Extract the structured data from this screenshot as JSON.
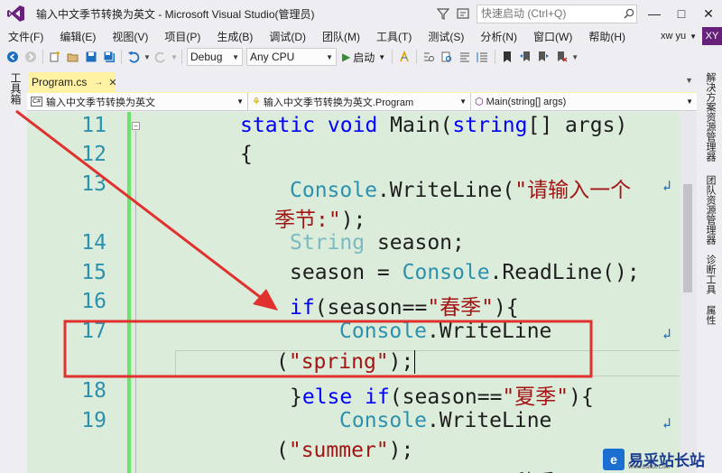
{
  "window": {
    "title": "输入中文季节转换为英文 - Microsoft Visual Studio(管理员)",
    "quick_launch_placeholder": "快速启动 (Ctrl+Q)",
    "user": "xw yu",
    "avatar": "XY"
  },
  "menu": [
    "文件(F)",
    "编辑(E)",
    "视图(V)",
    "项目(P)",
    "生成(B)",
    "调试(D)",
    "团队(M)",
    "工具(T)",
    "测试(S)",
    "分析(N)",
    "窗口(W)",
    "帮助(H)"
  ],
  "toolbar": {
    "config": "Debug",
    "platform": "Any CPU",
    "start": "启动"
  },
  "left_tab": "工具箱",
  "document_tab": "Program.cs",
  "navbar": {
    "project": "输入中文季节转换为英文",
    "class": "输入中文季节转换为英文.Program",
    "member": "Main(string[] args)"
  },
  "code_lines": [
    {
      "num": "11"
    },
    {
      "num": "12"
    },
    {
      "num": "13"
    },
    {
      "num": "14"
    },
    {
      "num": "15"
    },
    {
      "num": "16"
    },
    {
      "num": "17"
    },
    {
      "num": "18"
    },
    {
      "num": "19"
    }
  ],
  "code": {
    "l11_kw": "static void",
    "l11_rest": " Main(",
    "l11_type": "string",
    "l11_end": "[] args)",
    "l12": "{",
    "l13_type": "Console",
    "l13_method": ".WriteLine(",
    "l13_str": "\"请输入一个",
    "l13b_str": "季节:\"",
    "l13b_end": ");",
    "l14_type": "String",
    "l14_rest": " season;",
    "l15_a": "season = ",
    "l15_type": "Console",
    "l15_rest": ".ReadLine();",
    "l16_kw": "if",
    "l16_a": "(season==",
    "l16_str": "\"春季\"",
    "l16_end": "){",
    "l17_type": "Console",
    "l17_method": ".WriteLine",
    "l17b_open": "(",
    "l17b_str": "\"spring\"",
    "l17b_end": ");",
    "l18_a": "}",
    "l18_kw": "else if",
    "l18_b": "(season==",
    "l18_str": "\"夏季\"",
    "l18_end": "){",
    "l19_type": "Console",
    "l19_method": ".WriteLine",
    "l19b_open": "(",
    "l19b_str": "\"summer\"",
    "l19b_end": ");",
    "l20_partial": "}else if(season==\"秋季\"){"
  },
  "right_panel": [
    "解决方案资源管理器",
    "团队资源管理器",
    "诊断工具",
    "属性"
  ],
  "watermark": {
    "logo": "e",
    "text": "易采站长站",
    "sub": "Www.Easck.Com"
  },
  "colors": {
    "editor_bg": "#dcecda",
    "keyword": "#0000ff",
    "type": "#2b91af",
    "string": "#a31515",
    "annotation": "#e0312e",
    "tab_highlight": "#fff2a2"
  }
}
